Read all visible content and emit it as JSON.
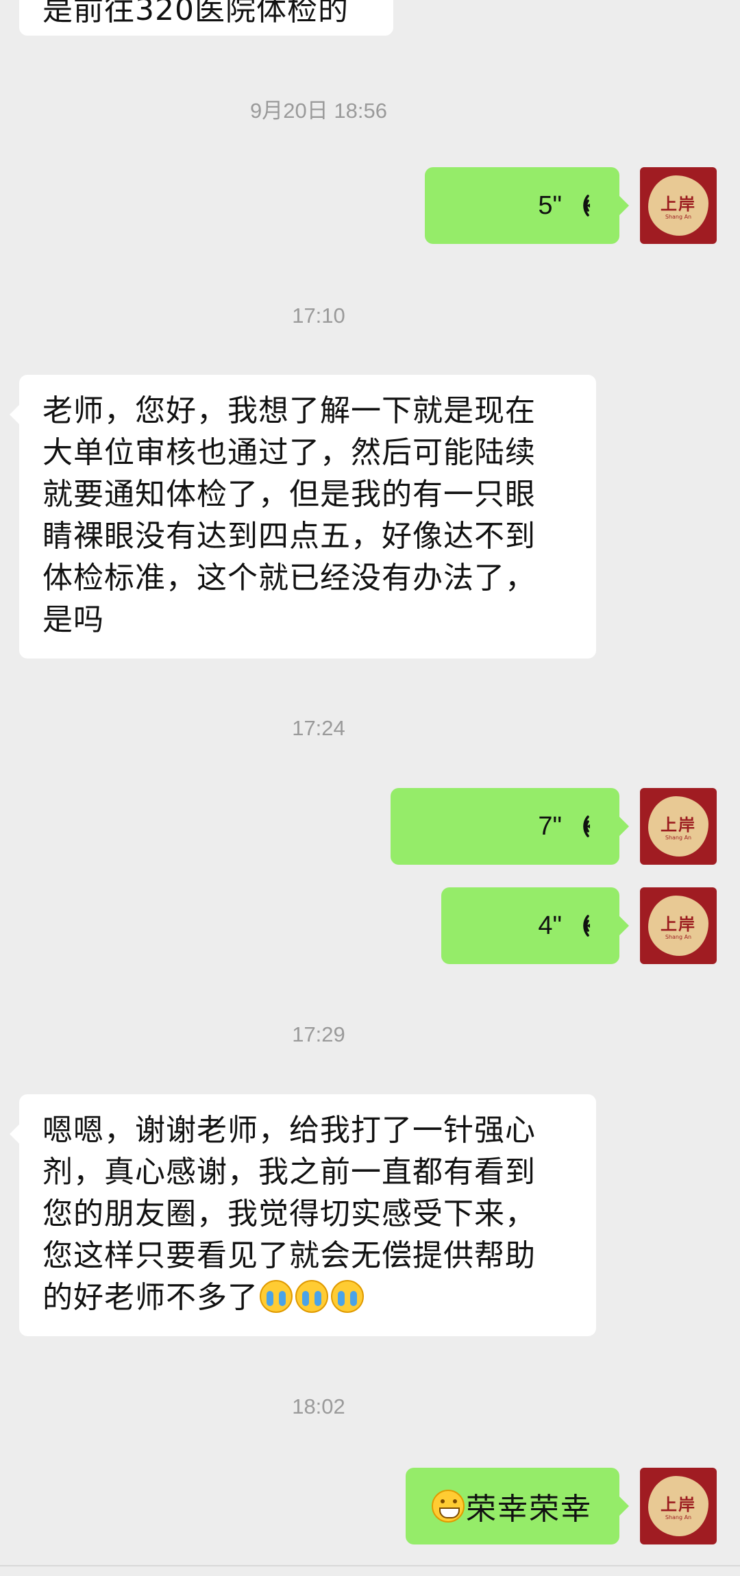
{
  "chat": {
    "top_partial_text": "是前往320医院体检的",
    "timestamps": [
      "9月20日 18:56",
      "17:10",
      "17:24",
      "17:29",
      "18:02"
    ],
    "messages": [
      {
        "side": "right",
        "type": "voice",
        "duration": "5\""
      },
      {
        "side": "left",
        "type": "text",
        "lines": [
          "老师，您好，我想了解一下就是现在",
          "大单位审核也通过了，然后可能陆续",
          "就要通知体检了，但是我的有一只眼",
          "睛裸眼没有达到四点五，好像达不到",
          "体检标准，这个就已经没有办法了，",
          "是吗"
        ]
      },
      {
        "side": "right",
        "type": "voice",
        "duration": "7\""
      },
      {
        "side": "right",
        "type": "voice",
        "duration": "4\""
      },
      {
        "side": "left",
        "type": "text",
        "lines": [
          "嗯嗯，谢谢老师，给我打了一针强心",
          "剂，真心感谢，我之前一直都有看到",
          "您的朋友圈，我觉得切实感受下来，",
          "您这样只要看见了就会无偿提供帮助",
          "的好老师不多了"
        ]
      },
      {
        "side": "right",
        "type": "text",
        "text": "荣幸荣幸",
        "emoji": "grin-icon"
      }
    ],
    "emoji_names": {
      "cry": "loudly-crying-face-icon",
      "grin": "grinning-face-icon"
    },
    "avatar": {
      "text": "上岸",
      "subtext": "Shang An"
    },
    "colors": {
      "background": "#ededed",
      "sent_bubble": "#95ec69",
      "received_bubble": "#ffffff",
      "timestamp": "#9a9a9a",
      "avatar_red": "#a01c22"
    }
  }
}
